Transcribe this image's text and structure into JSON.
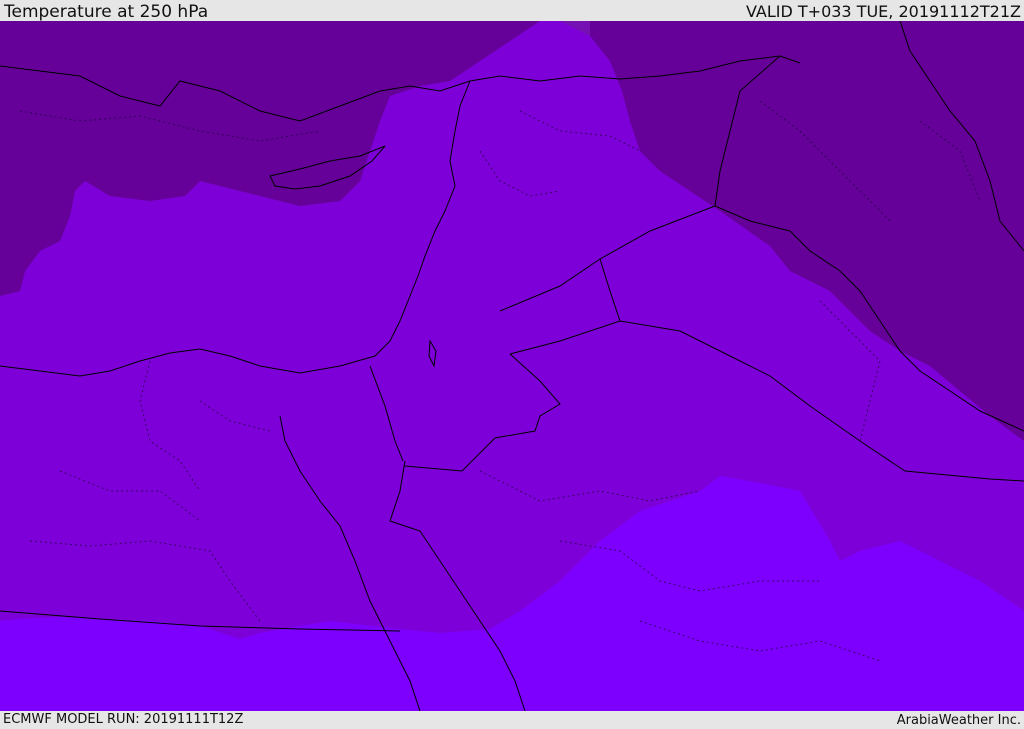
{
  "header": {
    "title": "Temperature at 250 hPa",
    "valid": "VALID T+033 TUE, 20191112T21Z"
  },
  "footer": {
    "model_run": "ECMWF MODEL RUN: 20191111T12Z",
    "credit": "ArabiaWeather Inc."
  },
  "map": {
    "colors": {
      "band_coldest": "#650099",
      "band_2": "#7510b2",
      "band_3": "#7e00d9",
      "band_warmest": "#7d00ff"
    }
  }
}
